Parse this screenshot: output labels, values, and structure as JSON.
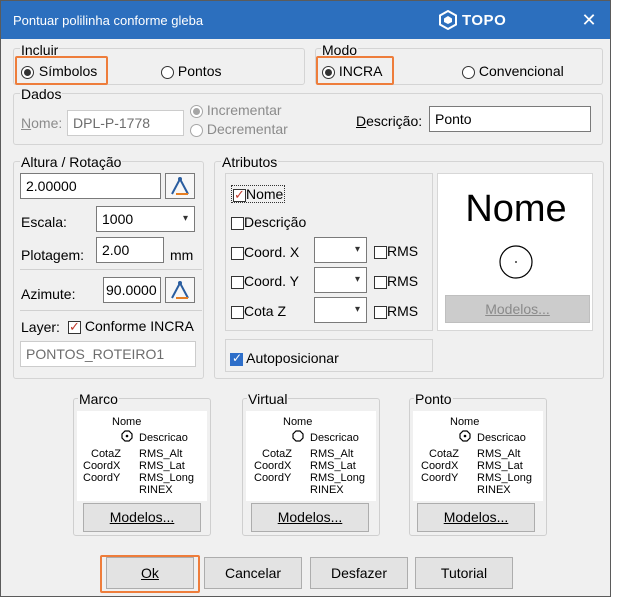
{
  "window": {
    "title": "Pontuar polilinha conforme gleba",
    "logo": "TOPO",
    "close_icon": "close-icon"
  },
  "incluir": {
    "label": "Incluir",
    "simbolos": "Símbolos",
    "pontos": "Pontos",
    "selected": "Símbolos"
  },
  "modo": {
    "label": "Modo",
    "incra": "INCRA",
    "convencional": "Convencional",
    "selected": "INCRA"
  },
  "dados": {
    "label": "Dados",
    "nome_label": "Nome:",
    "nome_value": "DPL-P-1778",
    "incrementar": "Incrementar",
    "decrementar": "Decrementar",
    "descricao_label": "Descrição:",
    "descricao_value": "Ponto"
  },
  "altura": {
    "label": "Altura / Rotação",
    "value": "2.00000",
    "escala_label": "Escala:",
    "escala_value": "1000",
    "plotagem_label": "Plotagem:",
    "plotagem_value": "2.00",
    "plotagem_unit": "mm",
    "azimute_label": "Azimute:",
    "azimute_value": "90.0000",
    "layer_label": "Layer:",
    "conforme_incra": "Conforme INCRA",
    "layer_value": "PONTOS_ROTEIRO1"
  },
  "atributos": {
    "label": "Atributos",
    "nome": "Nome",
    "descricao": "Descrição",
    "coord_x": "Coord. X",
    "coord_y": "Coord. Y",
    "cota_z": "Cota Z",
    "rms": "RMS",
    "autoposicionar": "Autoposicionar",
    "preview_name": "Nome",
    "modelos": "Modelos..."
  },
  "marco": {
    "label": "Marco",
    "nome": "Nome",
    "descricao": "Descricao",
    "left": [
      "CotaZ",
      "CoordX",
      "CoordY"
    ],
    "right": [
      "RMS_Alt",
      "RMS_Lat",
      "RMS_Long",
      "RINEX"
    ],
    "modelos": "Modelos..."
  },
  "virtual": {
    "label": "Virtual",
    "nome": "Nome",
    "descricao": "Descricao",
    "left": [
      "CotaZ",
      "CoordX",
      "CoordY"
    ],
    "right": [
      "RMS_Alt",
      "RMS_Lat",
      "RMS_Long",
      "RINEX"
    ],
    "modelos": "Modelos..."
  },
  "ponto": {
    "label": "Ponto",
    "nome": "Nome",
    "descricao": "Descricao",
    "left": [
      "CotaZ",
      "CoordX",
      "CoordY"
    ],
    "right": [
      "RMS_Alt",
      "RMS_Lat",
      "RMS_Long",
      "RINEX"
    ],
    "modelos": "Modelos..."
  },
  "buttons": {
    "ok": "Ok",
    "cancelar": "Cancelar",
    "desfazer": "Desfazer",
    "tutorial": "Tutorial"
  },
  "colors": {
    "titlebar": "#2c6fbe",
    "highlight": "#ee7d3b",
    "check_blue": "#2d6ec9"
  }
}
